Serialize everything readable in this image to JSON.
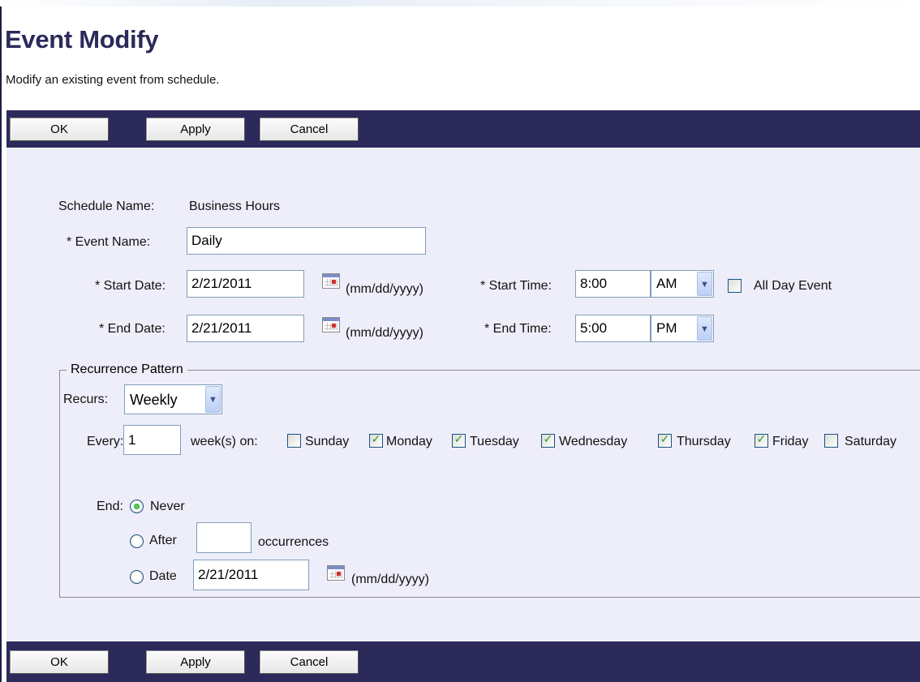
{
  "page": {
    "title": "Event Modify",
    "subtitle": "Modify an existing event from schedule."
  },
  "toolbar": {
    "ok_label": "OK",
    "apply_label": "Apply",
    "cancel_label": "Cancel"
  },
  "form": {
    "schedule_name_label": "Schedule Name:",
    "schedule_name_value": "Business Hours",
    "event_name_label": "* Event Name:",
    "event_name_value": "Daily",
    "start_date_label": "* Start Date:",
    "start_date_value": "2/21/2011",
    "end_date_label": "* End Date:",
    "end_date_value": "2/21/2011",
    "date_format_hint": "(mm/dd/yyyy)",
    "start_time_label": "* Start Time:",
    "start_time_value": "8:00",
    "start_ampm": "AM",
    "end_time_label": "* End Time:",
    "end_time_value": "5:00",
    "end_ampm": "PM",
    "all_day_label": "All Day Event",
    "all_day_checked": false
  },
  "recurrence": {
    "legend": "Recurrence Pattern",
    "recurs_label": "Recurs:",
    "recurs_value": "Weekly",
    "every_label": "Every:",
    "every_value": "1",
    "weeks_on_label": "week(s) on:",
    "days": [
      {
        "label": "Sunday",
        "checked": false
      },
      {
        "label": "Monday",
        "checked": true
      },
      {
        "label": "Tuesday",
        "checked": true
      },
      {
        "label": "Wednesday",
        "checked": true
      },
      {
        "label": "Thursday",
        "checked": true
      },
      {
        "label": "Friday",
        "checked": true
      },
      {
        "label": "Saturday",
        "checked": false
      }
    ],
    "end_label": "End:",
    "never_label": "Never",
    "after_label": "After",
    "after_value": "",
    "occurrences_label": "occurrences",
    "date_label": "Date",
    "end_date_value": "2/21/2011",
    "date_format_hint": "(mm/dd/yyyy)",
    "end_selected": "Never"
  },
  "colors": {
    "toolbar_bg": "#2c2a5a",
    "title_color": "#2c2a5a",
    "panel_bg": "#eeeefa",
    "check_color": "#21a121"
  },
  "icons": {
    "calendar": "calendar-icon",
    "dropdown": "chevron-down-icon",
    "check": "checkmark-icon"
  }
}
